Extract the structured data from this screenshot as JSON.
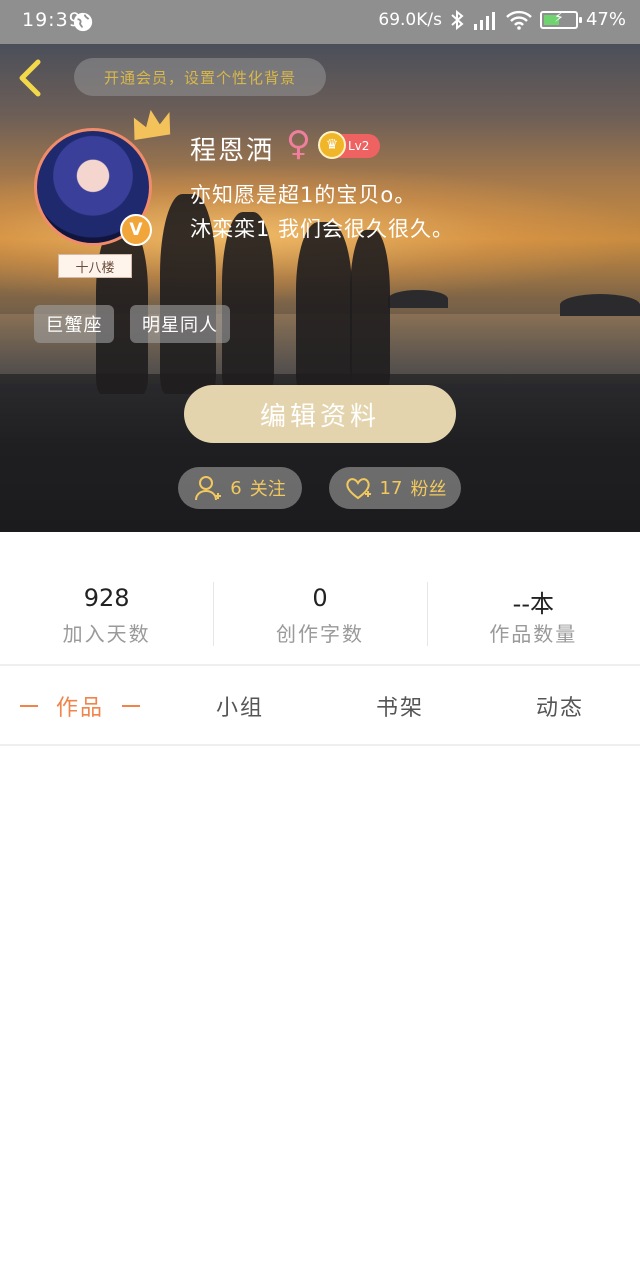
{
  "status_bar": {
    "time": "19:39",
    "network_speed": "69.0K/s",
    "battery_percent": "47%",
    "icons": [
      "globe-icon",
      "bluetooth-icon",
      "hd-signal-icon",
      "wifi-icon",
      "battery-charging-icon"
    ]
  },
  "header": {
    "vip_banner": "开通会员，设置个性化背景",
    "username": "程恩洒",
    "gender_symbol": "♀",
    "level": "Lv2",
    "bio_line1": "亦知愿是超1的宝贝o。",
    "bio_line2": "沐栾栾1 我们会很久很久。",
    "floor_tag": "十八楼",
    "verified_badge": "V",
    "tags": [
      "巨蟹座",
      "明星同人"
    ],
    "edit_button": "编辑资料",
    "follow": {
      "count": "6",
      "label": "关注"
    },
    "fans": {
      "count": "17",
      "label": "粉丝"
    }
  },
  "stats": [
    {
      "value": "928",
      "label": "加入天数"
    },
    {
      "value": "0",
      "label": "创作字数"
    },
    {
      "value": "--本",
      "label": "作品数量"
    }
  ],
  "tabs": [
    {
      "label": "作品",
      "active": true
    },
    {
      "label": "小组",
      "active": false
    },
    {
      "label": "书架",
      "active": false
    },
    {
      "label": "动态",
      "active": false
    }
  ],
  "colors": {
    "accent_orange": "#f0844b",
    "edit_button_bg": "#e4d4ae",
    "follow_text": "#f2c95e",
    "level_badge": "#ef6262"
  }
}
